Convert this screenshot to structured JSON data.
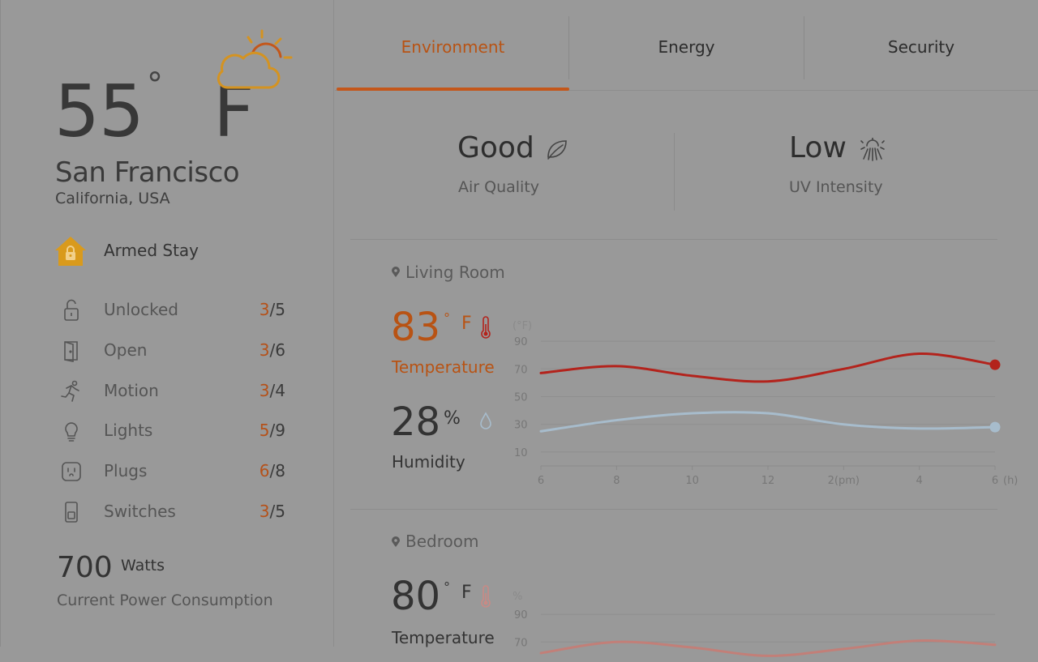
{
  "weather": {
    "temperature": "55",
    "degree": "°",
    "unit": "F",
    "city": "San Francisco",
    "region": "California, USA",
    "icon": "partly-cloudy-icon"
  },
  "security_status": {
    "label": "Armed Stay",
    "icon": "house-lock-icon"
  },
  "devices": [
    {
      "name": "unlocked",
      "label": "Unlocked",
      "active": "3",
      "total": "/5",
      "icon": "unlocked-padlock-icon"
    },
    {
      "name": "open",
      "label": "Open",
      "active": "3",
      "total": "/6",
      "icon": "door-icon"
    },
    {
      "name": "motion",
      "label": "Motion",
      "active": "3",
      "total": "/4",
      "icon": "running-person-icon"
    },
    {
      "name": "lights",
      "label": "Lights",
      "active": "5",
      "total": "/9",
      "icon": "lightbulb-icon"
    },
    {
      "name": "plugs",
      "label": "Plugs",
      "active": "6",
      "total": "/8",
      "icon": "plug-icon"
    },
    {
      "name": "switches",
      "label": "Switches",
      "active": "3",
      "total": "/5",
      "icon": "switch-icon"
    }
  ],
  "power": {
    "value": "700",
    "unit": "Watts",
    "label": "Current Power Consumption"
  },
  "tabs": [
    {
      "label": "Environment",
      "active": true
    },
    {
      "label": "Energy",
      "active": false
    },
    {
      "label": "Security",
      "active": false
    }
  ],
  "environment": {
    "air_quality": {
      "value": "Good",
      "label": "Air Quality",
      "icon": "leaf-icon"
    },
    "uv": {
      "value": "Low",
      "label": "UV Intensity",
      "icon": "sun-rays-icon"
    }
  },
  "rooms": [
    {
      "name": "Living Room",
      "temperature": {
        "value": "83",
        "degree": "°",
        "unit": "F",
        "label": "Temperature"
      },
      "humidity": {
        "value": "28",
        "unit": "%",
        "label": "Humidity"
      }
    },
    {
      "name": "Bedroom",
      "temperature": {
        "value": "80",
        "degree": "°",
        "unit": "F",
        "label": "Temperature"
      }
    }
  ],
  "colors": {
    "accent": "#c4571a",
    "temperature_line": "#b3231c",
    "humidity_line": "#a7bccc",
    "alarm_icon": "#d99a1c"
  },
  "chart_data": [
    {
      "type": "line",
      "room": "Living Room",
      "y_unit": "(°F)",
      "x_unit": "(h)",
      "x_ticks": [
        "6",
        "8",
        "10",
        "12",
        "2(pm)",
        "4",
        "6"
      ],
      "x": [
        6,
        8,
        10,
        12,
        14,
        16,
        18
      ],
      "ylim": [
        0,
        100
      ],
      "y_ticks": [
        "90",
        "70",
        "50",
        "30",
        "10"
      ],
      "series": [
        {
          "name": "Temperature",
          "values": [
            67,
            72,
            65,
            61,
            70,
            81,
            73
          ]
        },
        {
          "name": "Humidity",
          "values": [
            25,
            33,
            38,
            38,
            30,
            27,
            28
          ]
        }
      ]
    },
    {
      "type": "line",
      "room": "Bedroom",
      "y_unit": "%",
      "ylim": [
        0,
        100
      ],
      "y_ticks": [
        "90",
        "70"
      ],
      "series": [
        {
          "name": "Temperature",
          "values": [
            62,
            70,
            66,
            60,
            65,
            71,
            68
          ]
        }
      ]
    }
  ]
}
